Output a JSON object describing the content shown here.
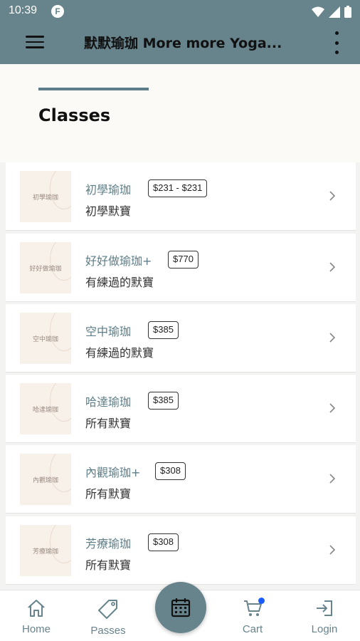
{
  "status_bar": {
    "time": "10:39",
    "app_icon_letter": "F"
  },
  "app_bar": {
    "title": "默默瑜珈 More more Yoga...",
    "menu_icon": "hamburger-icon",
    "more_icon": "more-vertical-icon"
  },
  "hero": {
    "title": "Classes"
  },
  "classes": [
    {
      "name": "初學瑜珈",
      "price": "$231 - $231",
      "subtitle": "初學默寶",
      "thumb_text": "初學瑜珈"
    },
    {
      "name": "好好做瑜珈+",
      "price": "$770",
      "subtitle": "有練過的默寶",
      "thumb_text": "好好做瑜珈"
    },
    {
      "name": "空中瑜珈",
      "price": "$385",
      "subtitle": "有練過的默寶",
      "thumb_text": "空中瑜珈"
    },
    {
      "name": "哈達瑜珈",
      "price": "$385",
      "subtitle": "所有默寶",
      "thumb_text": "哈達瑜珈"
    },
    {
      "name": "內觀瑜珈+",
      "price": "$308",
      "subtitle": "所有默寶",
      "thumb_text": "內觀瑜珈"
    },
    {
      "name": "芳療瑜珈",
      "price": "$308",
      "subtitle": "所有默寶",
      "thumb_text": "芳療瑜珈"
    }
  ],
  "bottom_nav": {
    "home": "Home",
    "passes": "Passes",
    "cart": "Cart",
    "login": "Login",
    "fab_icon": "calendar-icon"
  },
  "colors": {
    "primary": "#67838c",
    "accent_dot": "#1a5cff",
    "class_name": "#5d7e88"
  }
}
